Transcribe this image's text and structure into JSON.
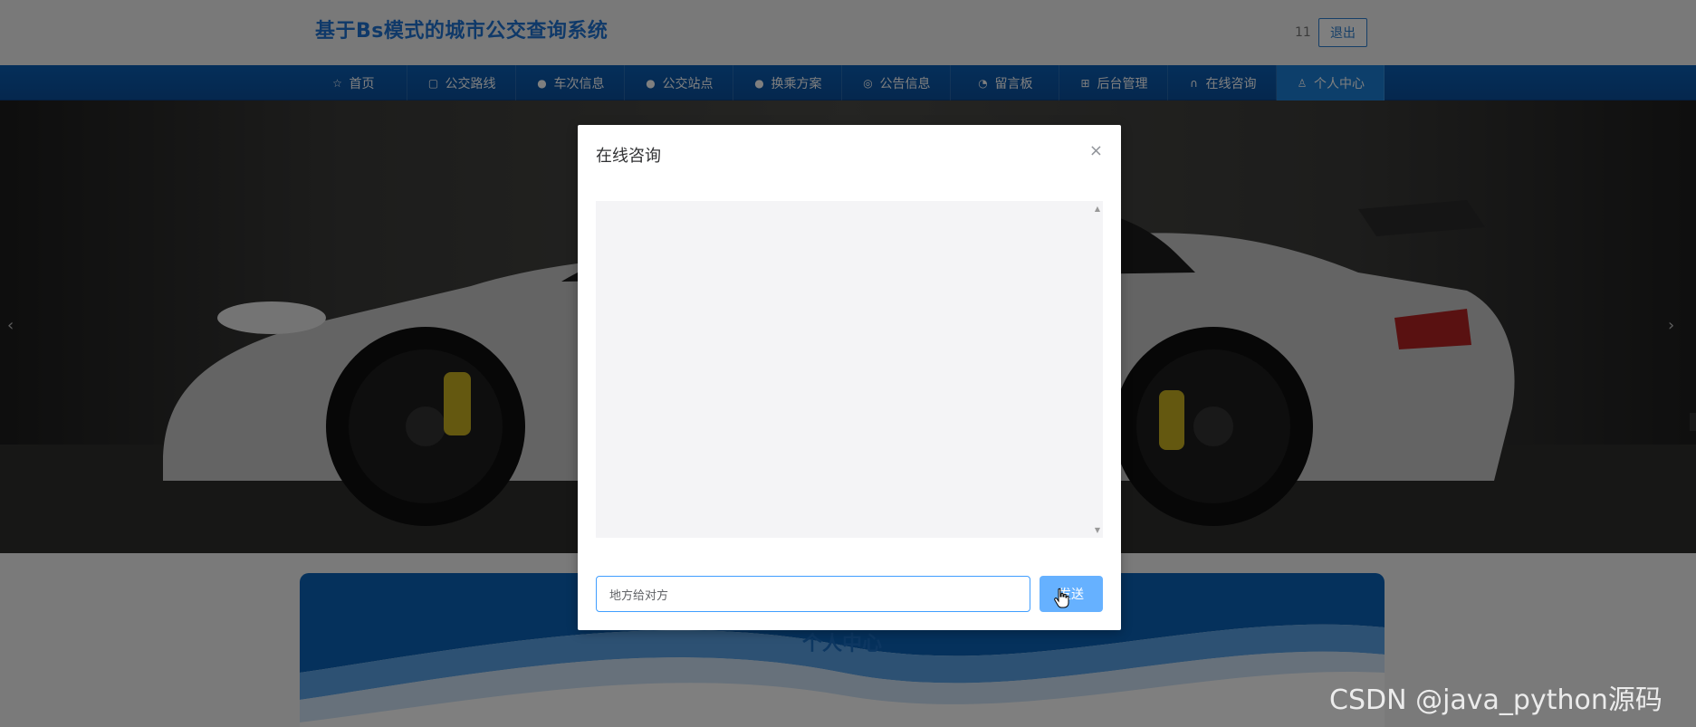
{
  "header": {
    "site_title": "基于Bs模式的城市公交查询系统",
    "user_name": "11",
    "logout_label": "退出"
  },
  "nav": {
    "items": [
      {
        "label": "首页",
        "icon": "star-icon",
        "active": false
      },
      {
        "label": "公交路线",
        "icon": "bag-icon",
        "active": false
      },
      {
        "label": "车次信息",
        "icon": "info-icon",
        "active": false
      },
      {
        "label": "公交站点",
        "icon": "help-icon",
        "active": false
      },
      {
        "label": "换乘方案",
        "icon": "info-icon",
        "active": false
      },
      {
        "label": "公告信息",
        "icon": "globe-icon",
        "active": false
      },
      {
        "label": "留言板",
        "icon": "chart-icon",
        "active": false
      },
      {
        "label": "后台管理",
        "icon": "gift-icon",
        "active": false
      },
      {
        "label": "在线咨询",
        "icon": "headset-icon",
        "active": false
      },
      {
        "label": "个人中心",
        "icon": "user-icon",
        "active": true
      }
    ]
  },
  "hero": {
    "prev_arrow": "‹",
    "next_arrow": "›"
  },
  "card": {
    "title": "个人中心"
  },
  "modal": {
    "title": "在线咨询",
    "close_symbol": "×",
    "input_value": "地方给对方",
    "send_label": "发送"
  },
  "watermark": "CSDN @java_python源码"
}
